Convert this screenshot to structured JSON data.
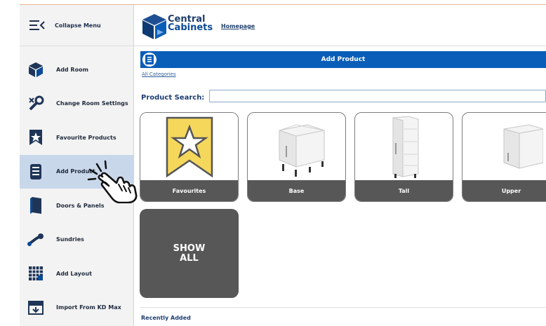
{
  "sidebar": {
    "collapse_label": "Collapse Menu",
    "items": [
      {
        "label": "Add Room",
        "icon": "cube-icon"
      },
      {
        "label": "Change Room Settings",
        "icon": "room-settings-icon"
      },
      {
        "label": "Favourite Products",
        "icon": "star-ribbon-icon"
      },
      {
        "label": "Add Product",
        "icon": "add-product-icon"
      },
      {
        "label": "Doors & Panels",
        "icon": "door-panel-icon"
      },
      {
        "label": "Sundries",
        "icon": "sundries-icon"
      },
      {
        "label": "Add Layout",
        "icon": "layout-grid-icon"
      },
      {
        "label": "Import From KD Max",
        "icon": "kd-max-import-icon"
      }
    ],
    "active_index": 3
  },
  "header": {
    "brand_line1": "Central",
    "brand_line2": "Cabinets",
    "home_link": "Homepage"
  },
  "main": {
    "title": "Add Product",
    "breadcrumb": "All Categories",
    "search_label": "Product Search:",
    "search_value": "",
    "categories": [
      {
        "label": "Favourites",
        "icon": "star-ribbon-icon"
      },
      {
        "label": "Base",
        "icon": "base-cabinet-icon"
      },
      {
        "label": "Tall",
        "icon": "tall-cabinet-icon"
      },
      {
        "label": "Upper",
        "icon": "upper-cabinet-icon"
      }
    ],
    "show_all_line1": "SHOW",
    "show_all_line2": "ALL",
    "recently_added": "Recently Added"
  },
  "colors": {
    "accent": "#0a5eb8",
    "active_item": "#c9d7ea",
    "caption_bg": "#575757",
    "favourite_yellow": "#f5d75c"
  }
}
